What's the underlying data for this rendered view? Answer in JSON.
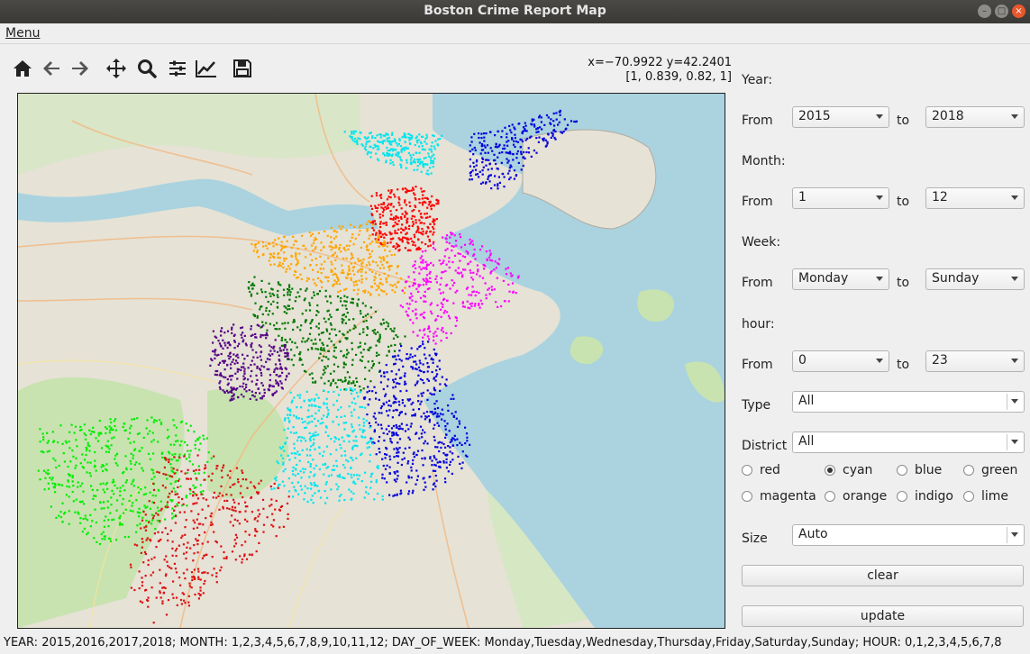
{
  "window": {
    "title": "Boston Crime Report Map"
  },
  "menu": {
    "label": "Menu"
  },
  "toolbar": {
    "icons": [
      "home-icon",
      "back-icon",
      "forward-icon",
      "pan-icon",
      "zoom-icon",
      "configure-subplots-icon",
      "edit-axis-icon",
      "save-icon"
    ]
  },
  "coords": {
    "line1": "x=−70.9922 y=42.2401",
    "line2": "[1, 0.839, 0.82, 1]"
  },
  "filters": {
    "year_label": "Year:",
    "from_label": "From",
    "to_label": "to",
    "year_from": "2015",
    "year_to": "2018",
    "month_label": "Month:",
    "month_from": "1",
    "month_to": "12",
    "week_label": "Week:",
    "week_from": "Monday",
    "week_to": "Sunday",
    "hour_label": "hour:",
    "hour_from": "0",
    "hour_to": "23",
    "type_label": "Type",
    "type_value": "All",
    "district_label": "District",
    "district_value": "All",
    "size_label": "Size",
    "size_value": "Auto"
  },
  "colors_radio": {
    "options": [
      "red",
      "cyan",
      "blue",
      "green",
      "magenta",
      "orange",
      "indigo",
      "lime"
    ],
    "selected": "cyan"
  },
  "buttons": {
    "clear": "clear",
    "update": "update"
  },
  "status": "YEAR: 2015,2016,2017,2018; MONTH: 1,2,3,4,5,6,7,8,9,10,11,12; DAY_OF_WEEK: Monday,Tuesday,Wednesday,Thursday,Friday,Saturday,Sunday; HOUR: 0,1,2,3,4,5,6,7,8",
  "map": {
    "background": "#e6e2d6",
    "water": "#aad3df",
    "park": "#c8e3b0",
    "district_colors": {
      "red": "#ff0000",
      "cyan": "#00e5ee",
      "blue": "#0000dd",
      "green": "#007700",
      "magenta": "#ff00ff",
      "orange": "#ffa500",
      "indigo": "#550088",
      "lime": "#00ee00",
      "darkred": "#dd1111"
    }
  }
}
